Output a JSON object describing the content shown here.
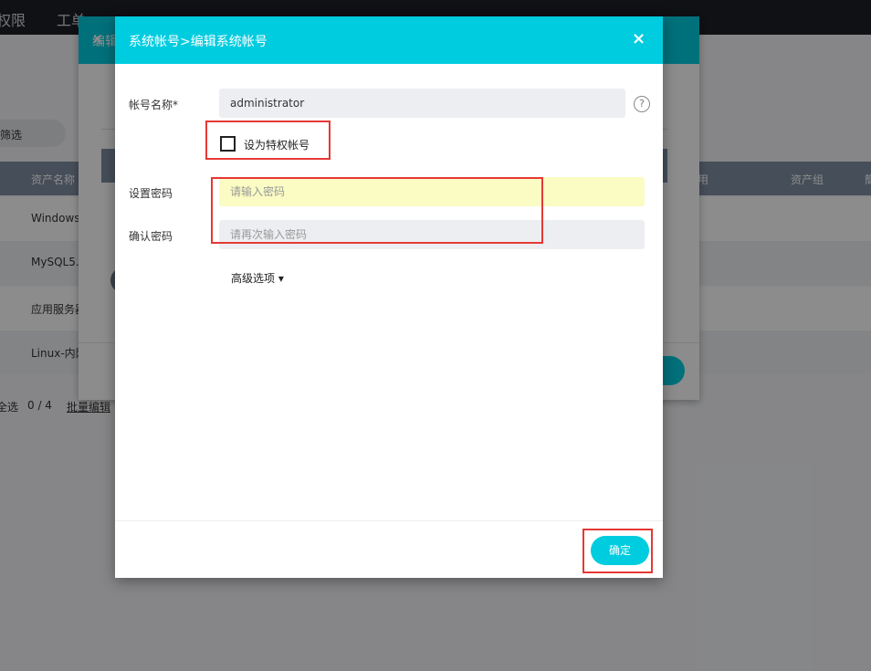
{
  "background": {
    "nav": {
      "item1": "权限",
      "item2": "工单"
    },
    "filter": "筛选",
    "table": {
      "headers": {
        "asset_name": "资产名称",
        "col_owner": "用",
        "asset_group": "资产组",
        "col_last": "簡"
      },
      "rows": [
        "Windows",
        "MySQL5.",
        "应用服务器",
        "Linux-内网"
      ]
    },
    "footer": {
      "select_all": "全选",
      "count": "0 / 4",
      "batch_edit": "批量编辑"
    },
    "back_modal_title": "编辑"
  },
  "modal": {
    "title": "系统帐号>编辑系统帐号",
    "close_icon": "×",
    "account_name_label": "帐号名称*",
    "account_name_value": "administrator",
    "help_icon": "?",
    "privileged_label": "设为特权帐号",
    "password_label": "设置密码",
    "password_placeholder": "请输入密码",
    "confirm_label": "确认密码",
    "confirm_placeholder": "请再次输入密码",
    "advanced_label": "高级选项 ▾",
    "ok_button": "确定"
  },
  "colors": {
    "accent": "#00cce0",
    "highlight_box": "#e53935",
    "password_field_bg": "#fafcc3",
    "field_bg": "#eceef1"
  }
}
